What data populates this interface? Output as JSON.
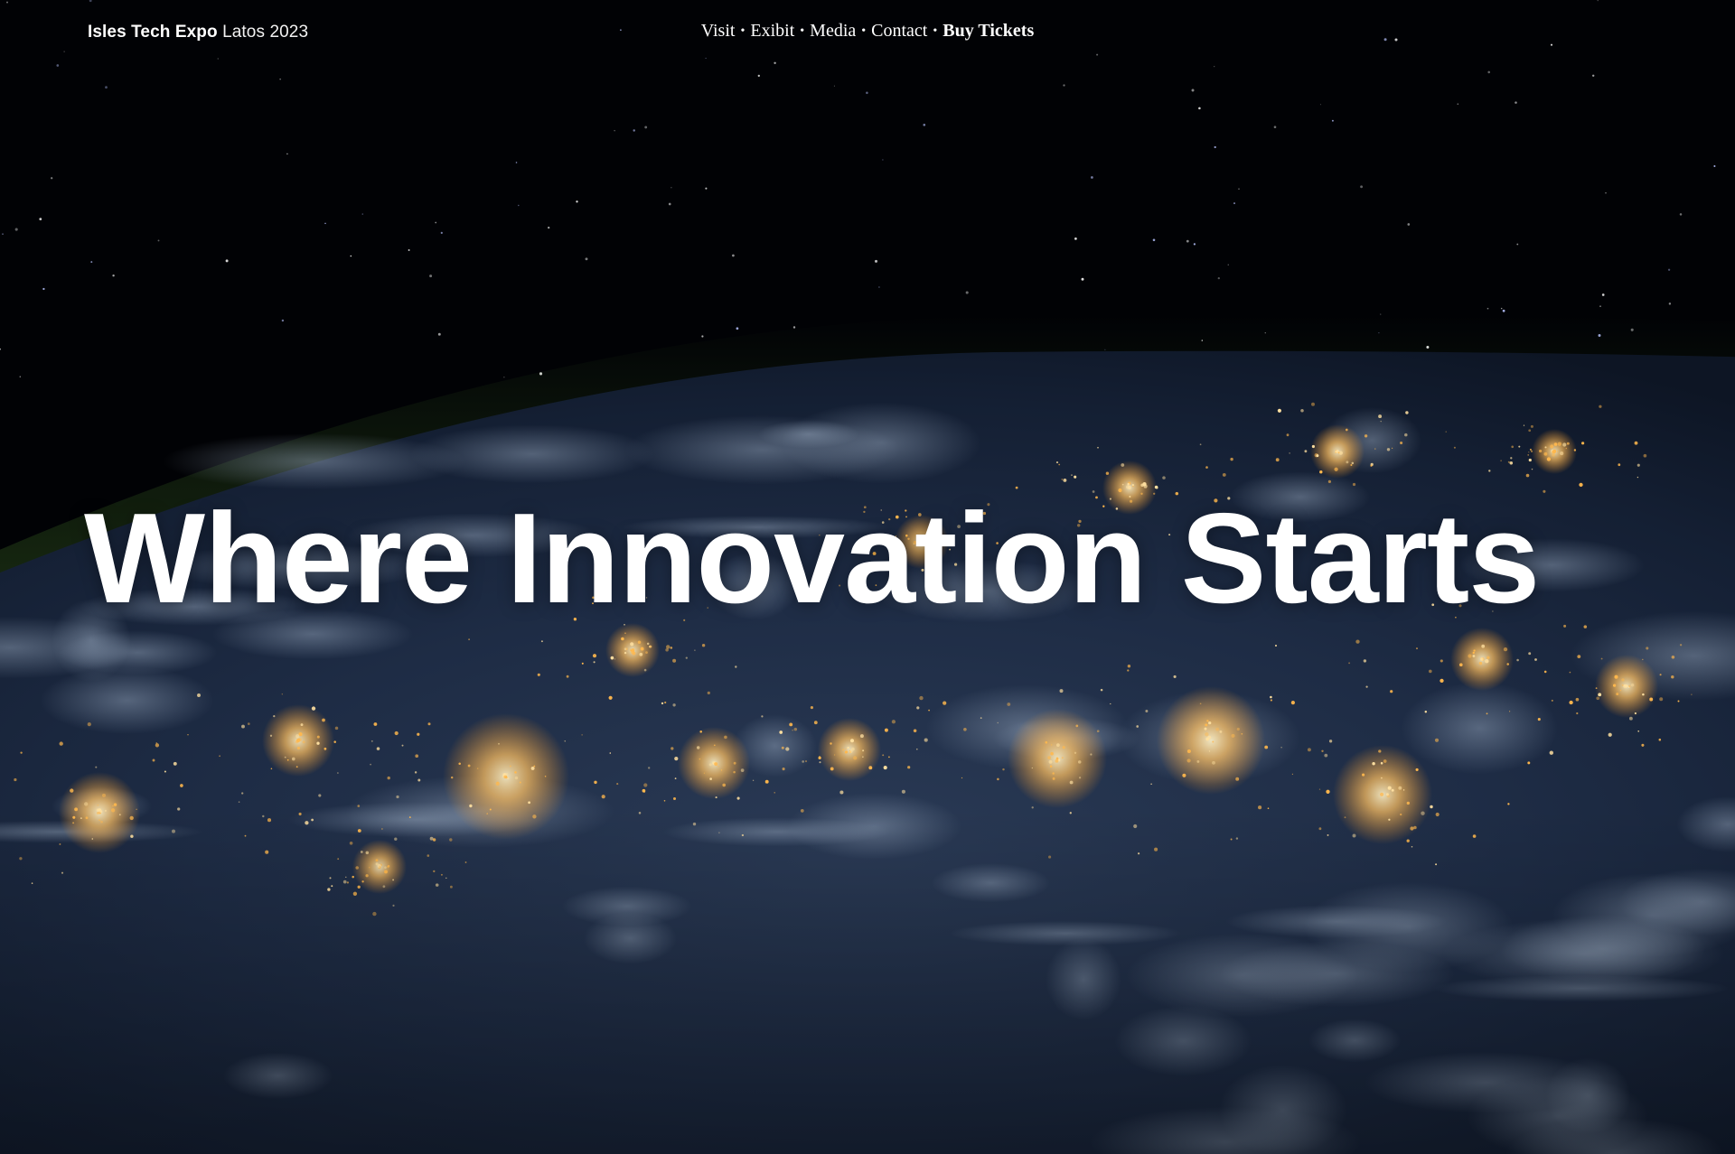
{
  "header": {
    "brand_name": "Isles Tech Expo",
    "brand_sub": "Latos 2023"
  },
  "nav": {
    "items": [
      {
        "label": "Visit"
      },
      {
        "label": "Exibit"
      },
      {
        "label": "Media"
      },
      {
        "label": "Contact"
      }
    ],
    "separator": "•",
    "cta_label": "Buy Tickets"
  },
  "hero": {
    "headline": "Where Innovation Starts",
    "background": "earth-at-night-from-space",
    "colors": {
      "space": "#010205",
      "ocean": "#1b2a44",
      "city_lights": "#ffb84d",
      "atmosphere": "#3a6a2a",
      "text": "#ffffff"
    }
  }
}
